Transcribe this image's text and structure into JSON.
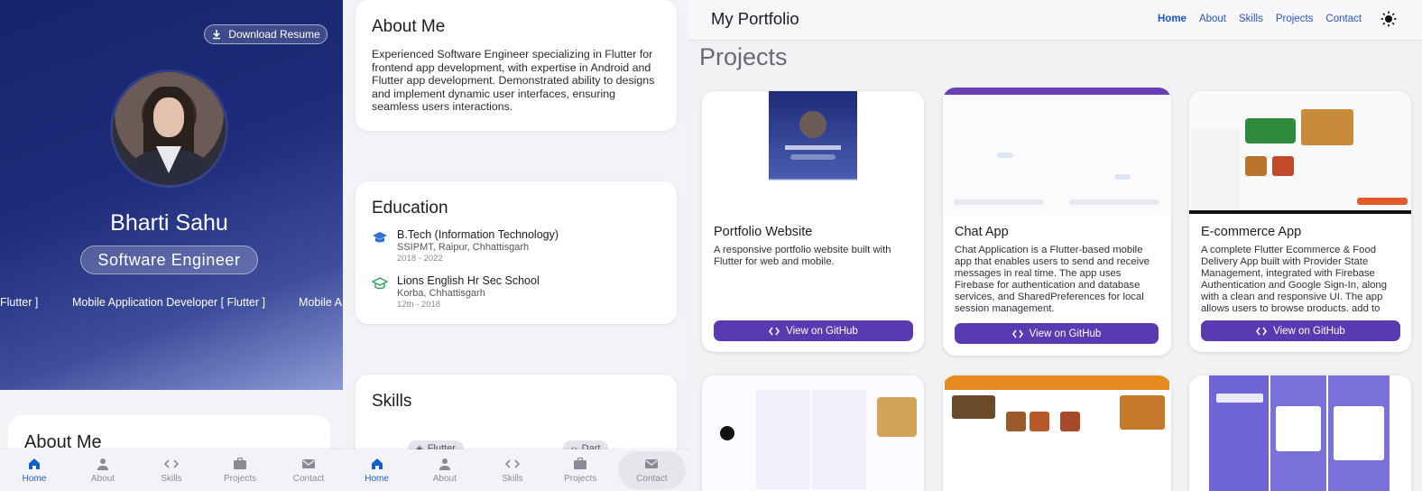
{
  "hero": {
    "download_label": "Download Resume",
    "name": "Bharti Sahu",
    "role": "Software Engineer",
    "marquee": [
      "Flutter ]",
      "Mobile Application Developer [ Flutter ]",
      "Mobile A"
    ]
  },
  "about_peek_title": "About Me",
  "nav_items": [
    "Home",
    "About",
    "Skills",
    "Projects",
    "Contact"
  ],
  "about": {
    "title": "About Me",
    "text": "Experienced Software Engineer specializing in Flutter for frontend app development, with expertise in Android and Flutter app development. Demonstrated ability to designs and implement dynamic user interfaces, ensuring seamless users interactions."
  },
  "education": {
    "title": "Education",
    "items": [
      {
        "degree": "B.Tech (Information Technology)",
        "school": "SSIPMT, Raipur, Chhattisgarh",
        "years": "2018 - 2022"
      },
      {
        "degree": "Lions English Hr Sec School",
        "school": "Korba, Chhattisgarh",
        "years": "12th - 2018"
      }
    ]
  },
  "skills": {
    "title": "Skills",
    "chips": [
      "Flutter",
      "Dart"
    ]
  },
  "portfolio": {
    "brand": "My Portfolio",
    "nav": [
      "Home",
      "About",
      "Skills",
      "Projects",
      "Contact"
    ],
    "section_title": "Projects",
    "projects": [
      {
        "title": "Portfolio Website",
        "desc": "A responsive portfolio website built with Flutter for web and mobile.",
        "button": "View on GitHub"
      },
      {
        "title": "Chat App",
        "desc": "Chat Application is a Flutter-based mobile app that enables users to send and receive messages in real time. The app uses Firebase for authentication and database services, and SharedPreferences for local session management.",
        "button": "View on GitHub"
      },
      {
        "title": "E-commerce App",
        "desc": "A complete Flutter Ecommerce & Food Delivery App built with Provider State Management, integrated with Firebase Authentication and Google Sign-In, along with a clean and responsive UI. The app allows users to browse products, add to cart,",
        "button": "View on GitHub"
      }
    ]
  },
  "colors": {
    "accent": "#5a3ab0",
    "hero_dark": "#16246e",
    "nav_active": "#1860c9"
  }
}
